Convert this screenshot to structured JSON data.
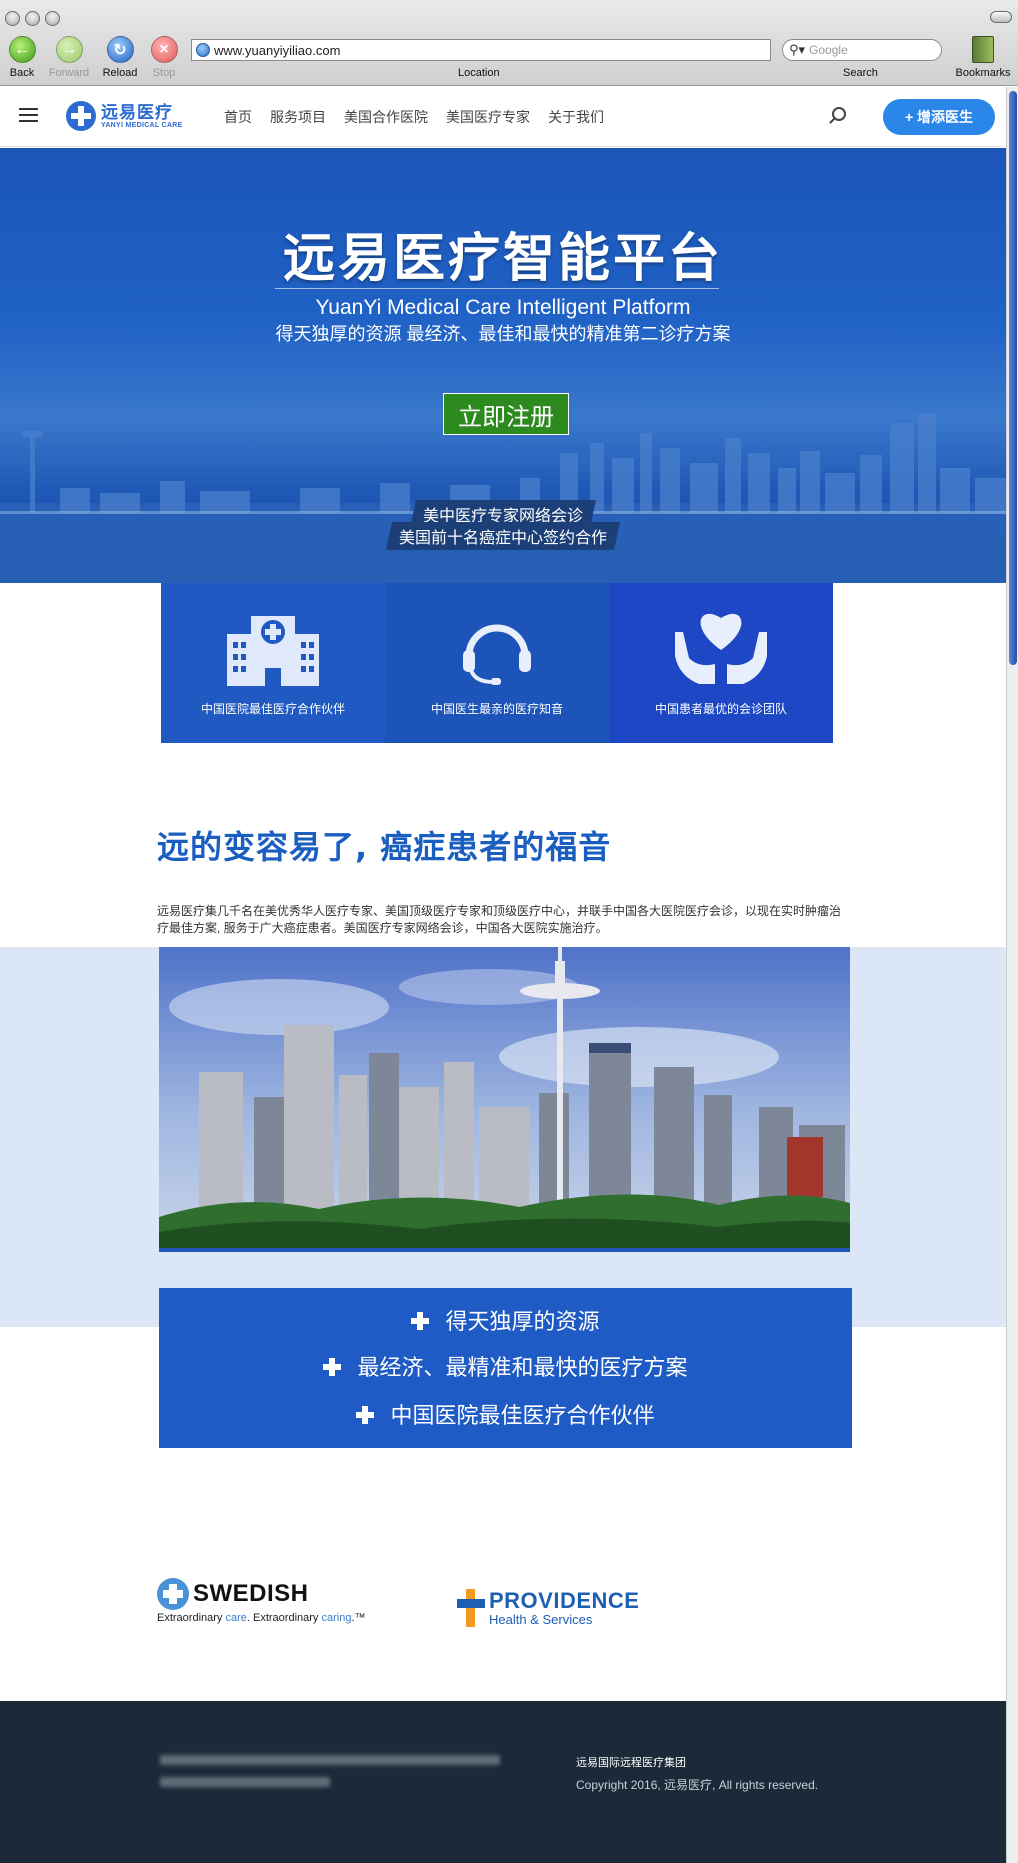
{
  "browser": {
    "nav": {
      "back": "Back",
      "forward": "Forward",
      "reload": "Reload",
      "stop": "Stop"
    },
    "url": "www.yuanyiyiliao.com",
    "location_label": "Location",
    "search_placeholder": "Google",
    "search_label": "Search",
    "bookmarks_label": "Bookmarks"
  },
  "header": {
    "logo_cn": "远易医疗",
    "logo_en": "YANYI MEDICAL CARE",
    "menu": [
      "首页",
      "服务项目",
      "美国合作医院",
      "美国医疗专家",
      "关于我们"
    ],
    "cta": "+ 增添医生"
  },
  "hero": {
    "title": "远易医疗智能平台",
    "subtitle_en": "YuanYi Medical Care Intelligent Platform",
    "subtitle_cn": "得天独厚的资源 最经济、最佳和最快的精准第二诊疗方案",
    "register": "立即注册",
    "tag1": "美中医疗专家网络会诊",
    "tag2": "美国前十名癌症中心签约合作"
  },
  "features": [
    {
      "label": "中国医院最佳医疗合作伙伴",
      "icon": "hospital-icon"
    },
    {
      "label": "中国医生最亲的医疗知音",
      "icon": "headset-icon"
    },
    {
      "label": "中国患者最优的会诊团队",
      "icon": "heart-hands-icon"
    }
  ],
  "intro": {
    "title": "远的变容易了, 癌症患者的福音",
    "body": "远易医疗集几千名在美优秀华人医疗专家、美国顶级医疗专家和顶级医疗中心，并联手中国各大医院医疗会诊，以现在实时肿瘤治疗最佳方案, 服务于广大癌症患者。美国医疗专家网络会诊，中国各大医院实施治疗。"
  },
  "points": [
    "得天独厚的资源",
    "最经济、最精准和最快的医疗方案",
    "中国医院最佳医疗合作伙伴"
  ],
  "partners": {
    "swedish": {
      "name": "SWEDISH",
      "tag_a": "Extraordinary ",
      "tag_b": "care",
      "tag_c": ". Extraordinary ",
      "tag_d": "caring",
      "tm": ".™"
    },
    "providence": {
      "name": "PROVIDENCE",
      "sub": "Health & Services"
    }
  },
  "footer": {
    "company": "远易国际远程医疗集团",
    "copyright": "Copyright 2016, 远易医疗, All rights reserved."
  },
  "colors": {
    "brand": "#2d6bd0",
    "hero": "#1f5bc4",
    "cta": "#2a86e8",
    "register": "#2d8a1f",
    "footer": "#1c2938"
  }
}
